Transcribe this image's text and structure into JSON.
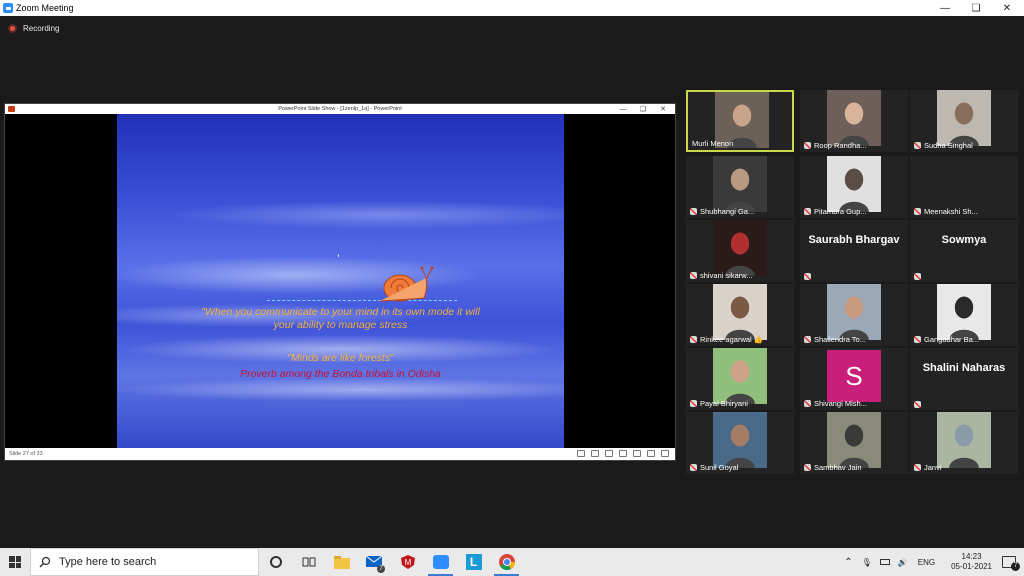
{
  "window": {
    "title": "Zoom Meeting"
  },
  "recording": {
    "label": "Recording"
  },
  "share": {
    "window_title": "PowerPoint Slide Show - [1zenlp_1a] - PowerPoint",
    "slide_status": "Slide 27 of 33",
    "quote_line1": "\"When you communicate to your mind in its own mode it will",
    "quote_line2": "your ability to manage stress",
    "quote_line3": "\"Minds are like forests\"",
    "quote_line4": "Proverb among the Bonda tribals in Odisha",
    "comma": "’"
  },
  "participants": [
    {
      "name": "Murli Menon",
      "type": "video",
      "active": true
    },
    {
      "name": "Roop Randha...",
      "type": "video"
    },
    {
      "name": "Sudha Singhal",
      "type": "video"
    },
    {
      "name": "Shubhangi Ga...",
      "type": "video"
    },
    {
      "name": "Pitambra Gup...",
      "type": "video"
    },
    {
      "name": "Meenakshi Sh...",
      "type": "none"
    },
    {
      "name": "shivani sikarw...",
      "type": "video"
    },
    {
      "name": "Saurabh Bhargav",
      "type": "name"
    },
    {
      "name": "Sowmya",
      "type": "name"
    },
    {
      "name": "Rinkee agarwal",
      "type": "video",
      "emoji": "👍"
    },
    {
      "name": "Shailendra To...",
      "type": "video"
    },
    {
      "name": "Gangadhar Ba...",
      "type": "video"
    },
    {
      "name": "Payal Bhiryani",
      "type": "video"
    },
    {
      "name": "Shivangi Mish...",
      "type": "avatar",
      "initial": "S"
    },
    {
      "name": "Shalini Naharas",
      "type": "name"
    },
    {
      "name": "Sunil Goyal",
      "type": "video"
    },
    {
      "name": "Sambhav Jain",
      "type": "video"
    },
    {
      "name": "Janvi",
      "type": "video"
    }
  ],
  "taskbar": {
    "search_placeholder": "Type here to search",
    "language": "ENG",
    "time": "14:23",
    "date": "05-01-2021",
    "notifications": "7",
    "mail_badge": "7"
  }
}
